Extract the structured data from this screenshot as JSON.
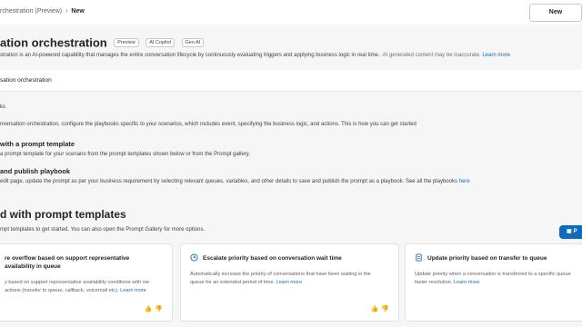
{
  "breadcrumb": {
    "parent": "rchestration (Preview)",
    "separator": "›",
    "current": "New"
  },
  "header": {
    "new_button": "New"
  },
  "page": {
    "title": "ation orchestration",
    "badges": [
      "Preview",
      "AI Copilot",
      "Gen AI"
    ],
    "description": "stration is an AI-powered capability that manages the entire conversation lifecycle by continuously evaluating triggers and applying business logic in real time.",
    "ai_note": "AI generated content may be inaccurate.",
    "learn_more": "Learn more"
  },
  "tab": {
    "label": "sation orchestration"
  },
  "steps": {
    "label": "ks",
    "intro": "nversation orchestration, configure the playbooks specific to your scenarios, which includes event, specifying the business logic, and actions. This is how you can get started",
    "step1_title": "with a prompt template",
    "step1_desc": "a prompt template for your scenario from the prompt templates shown below or from the Prompt gallery.",
    "step2_title": "and publish playbook",
    "step2_desc": "edit page, update the prompt as per your business requirement by selecting relevant queues, variables, and other details to save and publish the prompt as a playbook. See all the playbooks",
    "step2_link": "here"
  },
  "templates": {
    "title": "d with prompt templates",
    "subtitle": "mpt templates to get started. You can also open the Prompt Gallery for more options.",
    "button_label": "P",
    "cards": [
      {
        "title": "re overflow based on support representative availability in queue",
        "desc": "y based on support representative availability conditions with ow actions (transfer to queue, callback, voicemail etc).",
        "link": "Learn more"
      },
      {
        "title": "Escalate priority based on conversation wait time",
        "desc": "Automatically increase the priority of conversations that have been waiting in the queue for an extended period of time.",
        "link": "Learn more"
      },
      {
        "title": "Update priority based on transfer to queue",
        "desc": "Update priority when a conversation is transferred to a specific queue faster resolution.",
        "link": "Learn more"
      }
    ]
  },
  "colors": {
    "accent": "#0f6cbd"
  }
}
